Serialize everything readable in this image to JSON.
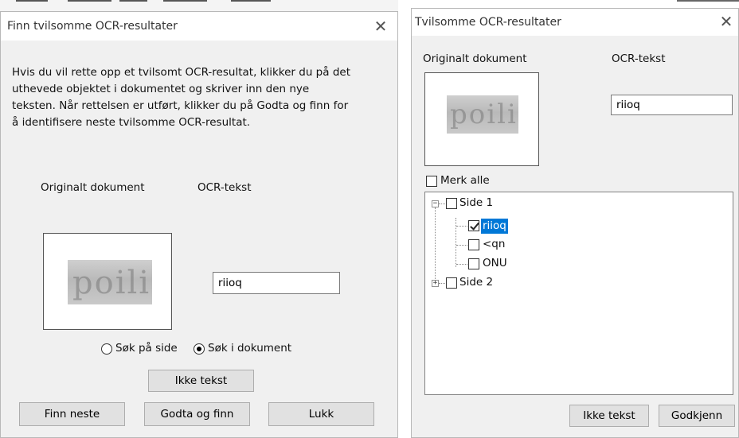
{
  "left_dialog": {
    "title": "Finn tvilsomme OCR-resultater",
    "instructions": [
      "Hvis du vil rette opp et tvilsomt OCR-resultat, klikker du på det",
      "uthevede objektet i dokumentet og skriver inn den nye",
      "teksten. Når rettelsen er utført, klikker du på Godta og finn for",
      "å identifisere neste tvilsomme OCR-resultat."
    ],
    "original_label": "Originalt dokument",
    "ocr_label": "OCR-tekst",
    "ocr_value": "riioq",
    "image_text": "poili",
    "radio_page": "Søk på side",
    "radio_document": "Søk i dokument",
    "radio_selected": "document",
    "not_text_button": "Ikke tekst",
    "find_next_button": "Finn neste",
    "accept_find_button": "Godta og finn",
    "close_button": "Lukk"
  },
  "right_dialog": {
    "title": "Tvilsomme OCR-resultater",
    "original_label": "Originalt dokument",
    "ocr_label": "OCR-tekst",
    "ocr_value": "riioq",
    "image_text": "poili",
    "select_all_label": "Merk alle",
    "tree": {
      "page1": "Side 1",
      "items": [
        {
          "label": "riioq",
          "checked": true,
          "selected": true
        },
        {
          "label": "<qn",
          "checked": false,
          "selected": false
        },
        {
          "label": "ONU",
          "checked": false,
          "selected": false
        }
      ],
      "page2": "Side 2"
    },
    "not_text_button": "Ikke tekst",
    "approve_button": "Godkjenn"
  },
  "colors": {
    "selection": "#0078d7",
    "button_face": "#e1e1e1",
    "dialog_face": "#f0f0f0"
  },
  "icons": {
    "close": "close-icon",
    "expand": "plus-box-icon",
    "collapse": "minus-box-icon"
  }
}
